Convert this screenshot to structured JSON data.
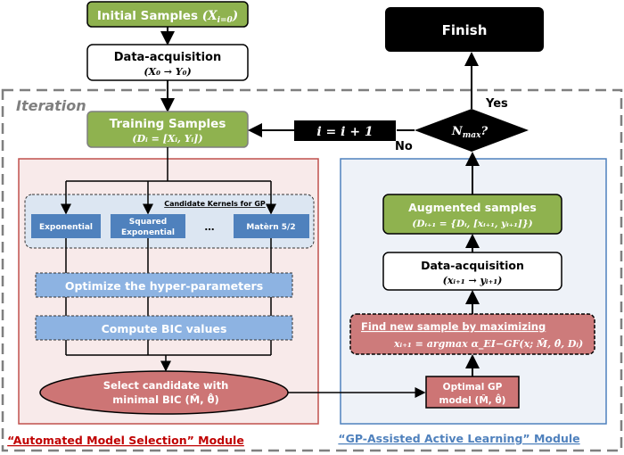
{
  "colors": {
    "green": "#8fb24f",
    "red_module_border": "#c0504d",
    "red_fill": "#cd7575",
    "blue_module_border": "#4f81bd",
    "kernel_blue": "#4f81bd",
    "light_blue": "#8db3e2"
  },
  "top": {
    "initial": "Initial Samples",
    "initial_math": "(X",
    "initial_sub": "i=0",
    "acq_title": "Data-acquisition",
    "acq_math": "(X₀ → Y₀)",
    "finish": "Finish"
  },
  "iteration": {
    "label": "Iteration",
    "training_title": "Training Samples",
    "training_math": "(Dᵢ = [Xᵢ, Yᵢ])",
    "increment": "i = i + 1",
    "decision": "N",
    "decision_sub": "max",
    "decision_q": "?",
    "yes": "Yes",
    "no": "No"
  },
  "left_module": {
    "title": "“Automated Model Selection” Module",
    "kernels_title": "Candidate Kernels for GP",
    "kernels": [
      "Exponential",
      "Squared",
      "Exponential",
      "Matèrn 5/2"
    ],
    "ellipsis": "…",
    "optimize": "Optimize the hyper-parameters",
    "bic": "Compute BIC values",
    "select_1": "Select candidate with",
    "select_2": "minimal BIC (M̂, θ̂)"
  },
  "right_module": {
    "title": "“GP-Assisted Active Learning” Module",
    "aug_title": "Augmented samples",
    "aug_math": "(Dᵢ₊₁ = {Dᵢ, [xᵢ₊₁, yᵢ₊₁]})",
    "acq_title": "Data-acquisition",
    "acq_math": "(xᵢ₊₁ → yᵢ₊₁)",
    "find_title": "Find new sample by maximizing",
    "find_math": "xᵢ₊₁ = argmax α_EI−GF(x; M̂, θ̂, Dᵢ)",
    "optimal_1": "Optimal GP",
    "optimal_2": "model (M̂, θ̂)"
  }
}
